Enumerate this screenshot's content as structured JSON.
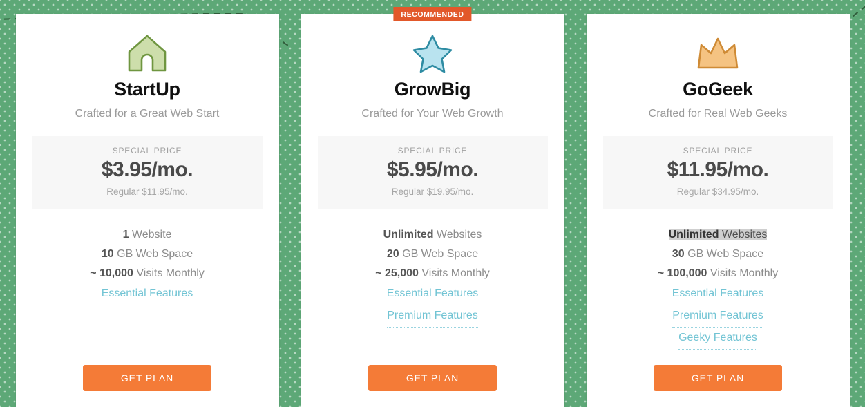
{
  "background": {
    "color": "#5da877",
    "dot_color": "#ffffff",
    "vine_color": "#2f5d3a"
  },
  "accent": {
    "cta_color": "#f47b37",
    "ribbon_color": "#e2582a",
    "link_color": "#72c4d4",
    "highlight_color": "#cfcfcf"
  },
  "plans": [
    {
      "icon": "house-icon",
      "icon_fill": "#cddeab",
      "icon_stroke": "#6f9640",
      "name": "StartUp",
      "tagline": "Crafted for a Great Web Start",
      "price_label": "SPECIAL PRICE",
      "price_main": "$3.95/mo.",
      "price_regular": "Regular $11.95/mo.",
      "features": [
        {
          "value": "1",
          "text": " Website",
          "highlighted": false
        },
        {
          "value": "10",
          "text": " GB Web Space",
          "highlighted": false
        },
        {
          "value": "~ 10,000",
          "text": " Visits Monthly",
          "highlighted": false
        }
      ],
      "links": [
        "Essential Features"
      ],
      "cta_label": "GET PLAN",
      "recommended": false,
      "ribbon_label": ""
    },
    {
      "icon": "star-icon",
      "icon_fill": "#b9e3ef",
      "icon_stroke": "#2e8ca3",
      "name": "GrowBig",
      "tagline": "Crafted for Your Web Growth",
      "price_label": "SPECIAL PRICE",
      "price_main": "$5.95/mo.",
      "price_regular": "Regular $19.95/mo.",
      "features": [
        {
          "value": "Unlimited",
          "text": " Websites",
          "highlighted": false
        },
        {
          "value": "20",
          "text": " GB Web Space",
          "highlighted": false
        },
        {
          "value": "~ 25,000",
          "text": " Visits Monthly",
          "highlighted": false
        }
      ],
      "links": [
        "Essential Features",
        "Premium Features"
      ],
      "cta_label": "GET PLAN",
      "recommended": true,
      "ribbon_label": "RECOMMENDED"
    },
    {
      "icon": "crown-icon",
      "icon_fill": "#f5c382",
      "icon_stroke": "#cf8b36",
      "name": "GoGeek",
      "tagline": "Crafted for Real Web Geeks",
      "price_label": "SPECIAL PRICE",
      "price_main": "$11.95/mo.",
      "price_regular": "Regular $34.95/mo.",
      "features": [
        {
          "value": "Unlimited",
          "text": " Websites",
          "highlighted": true
        },
        {
          "value": "30",
          "text": " GB Web Space",
          "highlighted": false
        },
        {
          "value": "~ 100,000",
          "text": " Visits Monthly",
          "highlighted": false
        }
      ],
      "links": [
        "Essential Features",
        "Premium Features",
        "Geeky Features"
      ],
      "cta_label": "GET PLAN",
      "recommended": false,
      "ribbon_label": ""
    }
  ]
}
